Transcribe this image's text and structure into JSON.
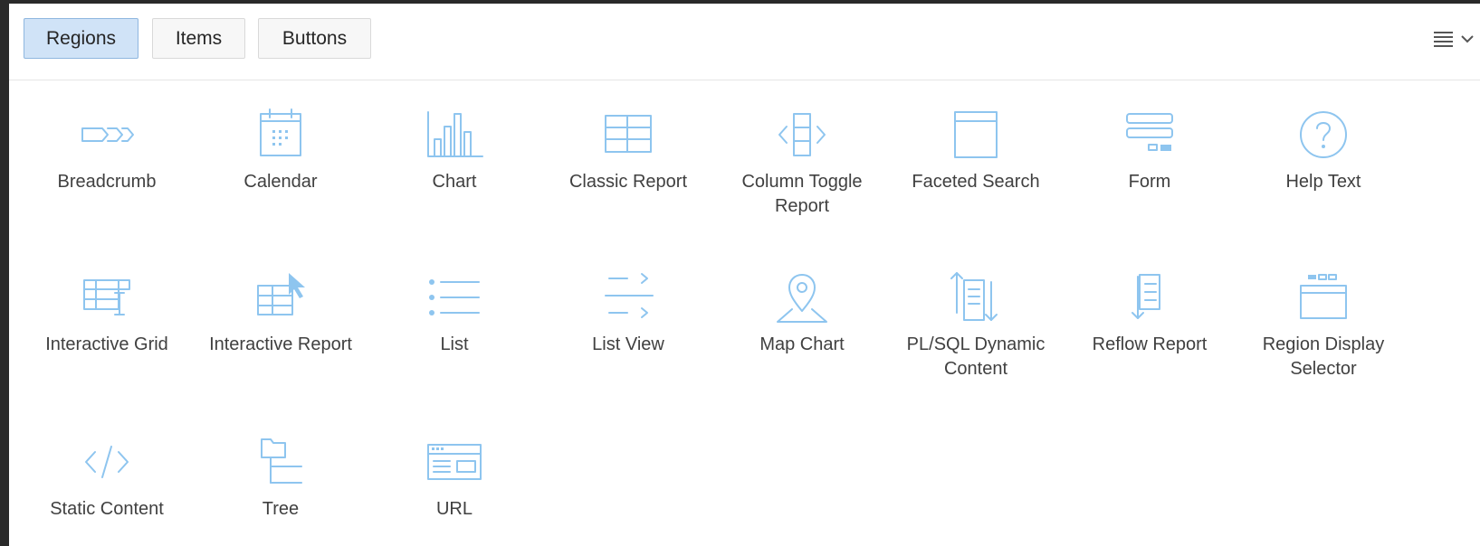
{
  "tabs": [
    {
      "label": "Regions",
      "active": true
    },
    {
      "label": "Items",
      "active": false
    },
    {
      "label": "Buttons",
      "active": false
    }
  ],
  "menu_toggle": {
    "icon": "list-menu-icon",
    "caret": "chevron-down-icon"
  },
  "regions": [
    {
      "label": "Breadcrumb",
      "icon": "breadcrumb-icon"
    },
    {
      "label": "Calendar",
      "icon": "calendar-icon"
    },
    {
      "label": "Chart",
      "icon": "bar-chart-icon"
    },
    {
      "label": "Classic Report",
      "icon": "table-icon"
    },
    {
      "label": "Column Toggle Report",
      "icon": "column-toggle-icon"
    },
    {
      "label": "Faceted Search",
      "icon": "window-icon"
    },
    {
      "label": "Form",
      "icon": "form-icon"
    },
    {
      "label": "Help Text",
      "icon": "help-icon"
    },
    {
      "label": "Interactive Grid",
      "icon": "interactive-grid-icon"
    },
    {
      "label": "Interactive Report",
      "icon": "interactive-report-icon"
    },
    {
      "label": "List",
      "icon": "list-icon"
    },
    {
      "label": "List View",
      "icon": "list-view-icon"
    },
    {
      "label": "Map Chart",
      "icon": "map-pin-icon"
    },
    {
      "label": "PL/SQL Dynamic Content",
      "icon": "plsql-dynamic-icon"
    },
    {
      "label": "Reflow Report",
      "icon": "reflow-report-icon"
    },
    {
      "label": "Region Display Selector",
      "icon": "region-selector-icon"
    },
    {
      "label": "Static Content",
      "icon": "code-icon"
    },
    {
      "label": "Tree",
      "icon": "tree-icon"
    },
    {
      "label": "URL",
      "icon": "url-icon"
    }
  ],
  "colors": {
    "icon": "#8ec5ef",
    "active_tab": "#d0e3f7",
    "active_tab_border": "#8fb7df"
  }
}
